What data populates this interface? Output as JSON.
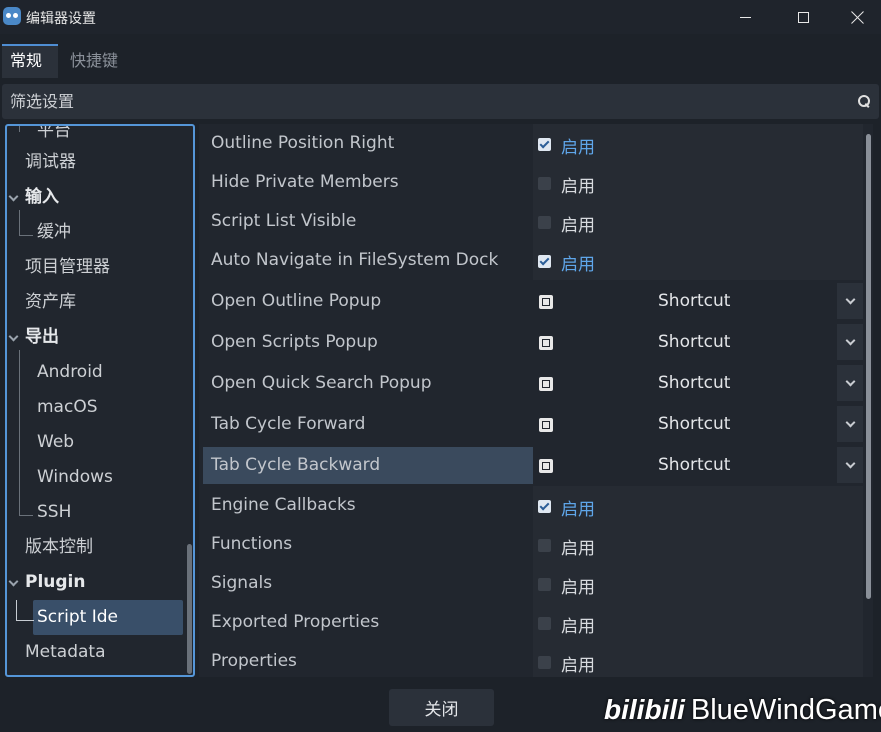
{
  "window": {
    "title": "编辑器设置"
  },
  "tabs": [
    {
      "label": "常规",
      "active": true
    },
    {
      "label": "快捷键",
      "active": false
    }
  ],
  "filter": {
    "placeholder": "筛选设置"
  },
  "sidebar": {
    "items": [
      {
        "label": "平台",
        "level": 1
      },
      {
        "label": "调试器",
        "level": 0
      },
      {
        "label": "输入",
        "level": 0,
        "bold": true,
        "expanded": true
      },
      {
        "label": "缓冲",
        "level": 1
      },
      {
        "label": "项目管理器",
        "level": 0
      },
      {
        "label": "资产库",
        "level": 0
      },
      {
        "label": "导出",
        "level": 0,
        "bold": true,
        "expanded": true
      },
      {
        "label": "Android",
        "level": 1
      },
      {
        "label": "macOS",
        "level": 1
      },
      {
        "label": "Web",
        "level": 1
      },
      {
        "label": "Windows",
        "level": 1
      },
      {
        "label": "SSH",
        "level": 1
      },
      {
        "label": "版本控制",
        "level": 0
      },
      {
        "label": "Plugin",
        "level": 0,
        "bold": true,
        "expanded": true
      },
      {
        "label": "Script Ide",
        "level": 1,
        "selected": true
      },
      {
        "label": "Metadata",
        "level": 0
      }
    ]
  },
  "settings": {
    "enabled_text": "启用",
    "shortcut_text": "Shortcut",
    "rows": [
      {
        "label": "Outline Position Right",
        "kind": "checkbox",
        "checked": true
      },
      {
        "label": "Hide Private Members",
        "kind": "checkbox",
        "checked": false
      },
      {
        "label": "Script List Visible",
        "kind": "checkbox",
        "checked": false
      },
      {
        "label": "Auto Navigate in FileSystem Dock",
        "kind": "checkbox",
        "checked": true
      },
      {
        "label": "Open Outline Popup",
        "kind": "shortcut"
      },
      {
        "label": "Open Scripts Popup",
        "kind": "shortcut"
      },
      {
        "label": "Open Quick Search Popup",
        "kind": "shortcut"
      },
      {
        "label": "Tab Cycle Forward",
        "kind": "shortcut"
      },
      {
        "label": "Tab Cycle Backward",
        "kind": "shortcut",
        "selected": true
      },
      {
        "label": "Engine Callbacks",
        "kind": "checkbox",
        "checked": true
      },
      {
        "label": "Functions",
        "kind": "checkbox",
        "checked": false
      },
      {
        "label": "Signals",
        "kind": "checkbox",
        "checked": false
      },
      {
        "label": "Exported Properties",
        "kind": "checkbox",
        "checked": false
      },
      {
        "label": "Properties",
        "kind": "checkbox",
        "checked": false
      }
    ]
  },
  "footer": {
    "close_label": "关闭"
  },
  "watermark": {
    "logo": "bilibili",
    "text": "BlueWindGame"
  },
  "colors": {
    "accent": "#5596d8",
    "enabled_text": "#5fa6ea",
    "selection": "#394f69"
  }
}
